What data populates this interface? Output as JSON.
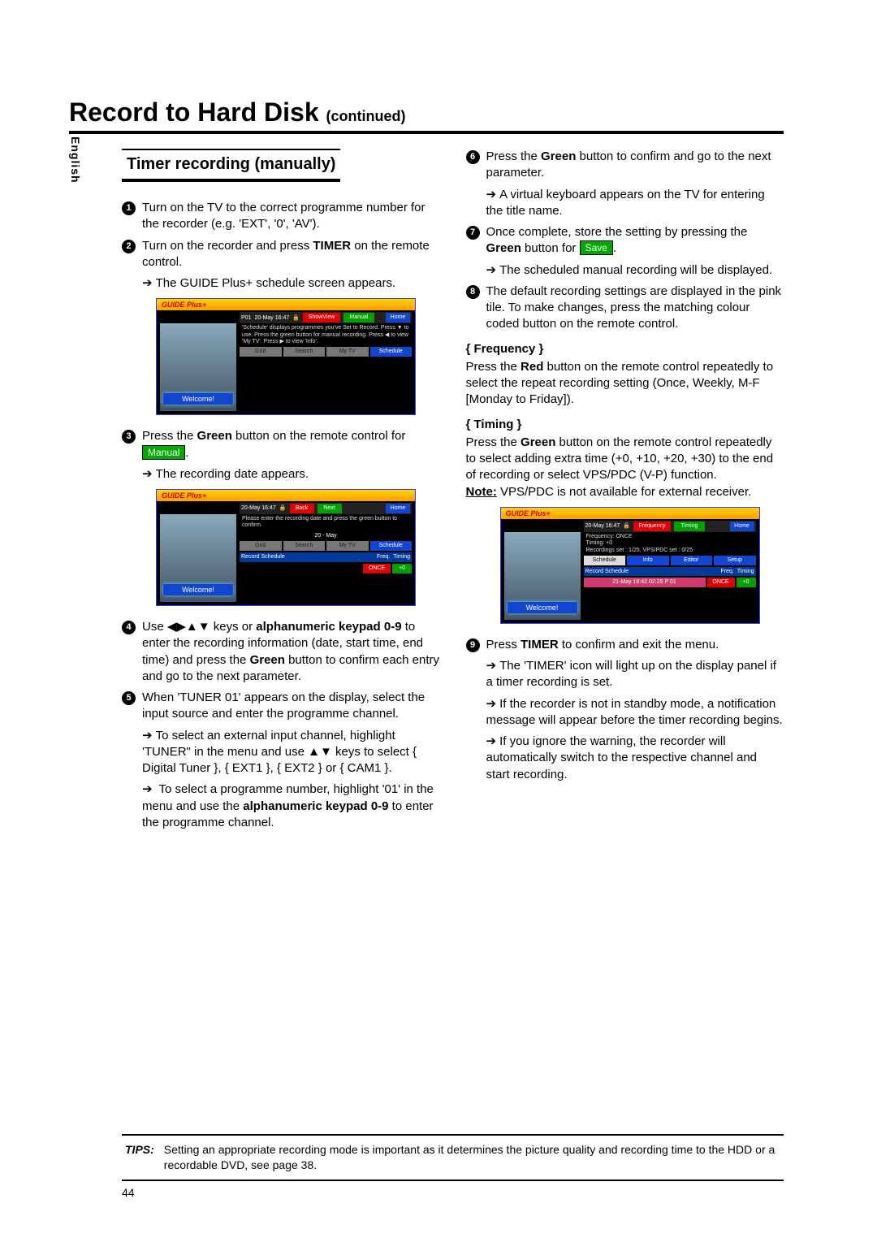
{
  "sideTab": "English",
  "title": "Record to Hard Disk",
  "titleSub": "(continued)",
  "subtitle": "Timer recording (manually)",
  "left": {
    "s1": "Turn on the TV to the correct programme number for the recorder (e.g. 'EXT', '0', 'AV').",
    "s2a": "Turn on the recorder and press ",
    "s2b": " on the remote control.",
    "s2_timer": "TIMER",
    "s2_arrow": "The GUIDE Plus+ schedule screen appears.",
    "s3a": "Press the ",
    "s3_green": "Green",
    "s3b": " button on the remote control for ",
    "s3_tag": "Manual",
    "s3_arrow": "The recording date appears.",
    "s4a": "Use ◀▶▲▼ keys or ",
    "s4_kp": "alphanumeric keypad 0-9",
    "s4b": " to enter the recording information (date, start time, end time) and press the ",
    "s4c": " button to confirm each entry and go to the next parameter.",
    "s5a": "When 'TUNER 01' appears on the display, select the input source and enter the programme channel.",
    "s5_arrow1": "To select an external input channel, highlight 'TUNER\" in the menu and use ▲▼ keys to select { Digital Tuner }, { EXT1 }, { EXT2 } or { CAM1 }.",
    "s5_arrow2a": "To select a programme number, highlight '01' in the menu and use the ",
    "s5_arrow2b": " to enter the programme channel."
  },
  "right": {
    "s6a": "Press the ",
    "s6b": " button to confirm and go to the next parameter.",
    "s6_arrow": "A virtual keyboard appears on the TV for entering the title name.",
    "s7a": "Once complete, store the setting by pressing the ",
    "s7b": " button for ",
    "s7_tag": "Save",
    "s7_arrow": "The scheduled manual recording will be displayed.",
    "s8": "The default recording settings are displayed in the pink tile. To make changes, press the matching colour coded button on the remote control.",
    "freq_head": "{ Frequency }",
    "freq_body_a": "Press the ",
    "freq_red": "Red",
    "freq_body_b": " button on the remote control repeatedly to select the repeat recording setting (Once, Weekly, M-F [Monday to Friday]).",
    "tim_head": "{ Timing }",
    "tim_body_a": "Press the ",
    "tim_body_b": " button on the remote control repeatedly to select adding extra time (+0, +10, +20, +30) to the end of recording or select VPS/PDC (V-P) function.",
    "tim_note_a": "Note:",
    "tim_note_b": " VPS/PDC is not available for external receiver.",
    "s9a": "Press ",
    "s9b": " to confirm and exit the menu.",
    "s9_arrow1": "The 'TIMER' icon will light up on the display panel if a timer recording is set.",
    "s9_arrow2": "If the recorder is not in standby mode, a notification message will appear before the timer recording begins.",
    "s9_arrow3": "If you ignore the warning, the recorder will automatically switch to the respective channel and start recording."
  },
  "mock1": {
    "logo": "GUIDE Plus+",
    "headP": "P01",
    "headDate": "20-May 16:47",
    "tab1": "ShowView",
    "tab2": "Manual",
    "home": "Home",
    "desc": "'Schedule' displays programmes you've Set to Record. Press ▼ to use. Press the green button for manual recording. Press ◀ to view 'My TV'. Press ▶ to view 'Info'.",
    "b1": "Grid",
    "b2": "Search",
    "b3": "My TV",
    "b4": "Schedule",
    "welcome": "Welcome!"
  },
  "mock2": {
    "headDate": "20-May 16:47",
    "back": "Back",
    "next": "Next",
    "home": "Home",
    "desc": "Please enter the recording date and press the green button to confirm.",
    "mid": "20 - May",
    "b1": "Grid",
    "b2": "Search",
    "b3": "My TV",
    "b4": "Schedule",
    "rs": "Record Schedule",
    "freq": "Freq.",
    "timing": "Timing",
    "once": "ONCE",
    "plus0": "+0",
    "welcome": "Welcome!"
  },
  "mock3": {
    "headDate": "20-May 16:47",
    "tab1": "Frequency",
    "tab2": "Timing",
    "home": "Home",
    "l1": "Frequency: ONCE",
    "l2": "Timing:  +0",
    "l3": "Recordings set :  1/25.  VPS/PDC set : 0/25",
    "b1": "Schedule",
    "b2": "Info",
    "b3": "Editor",
    "b4": "Setup",
    "rs": "Record Schedule",
    "freq": "Freq.",
    "timing": "Timing",
    "row": "21-May 18:42 02:25 P 01",
    "once": "ONCE",
    "plus0": "+0",
    "welcome": "Welcome!"
  },
  "tips": {
    "label": "TIPS:",
    "text": "Setting an appropriate recording mode is important as it determines the picture quality and recording time to the HDD or a recordable DVD, see page 38."
  },
  "pageNum": "44"
}
